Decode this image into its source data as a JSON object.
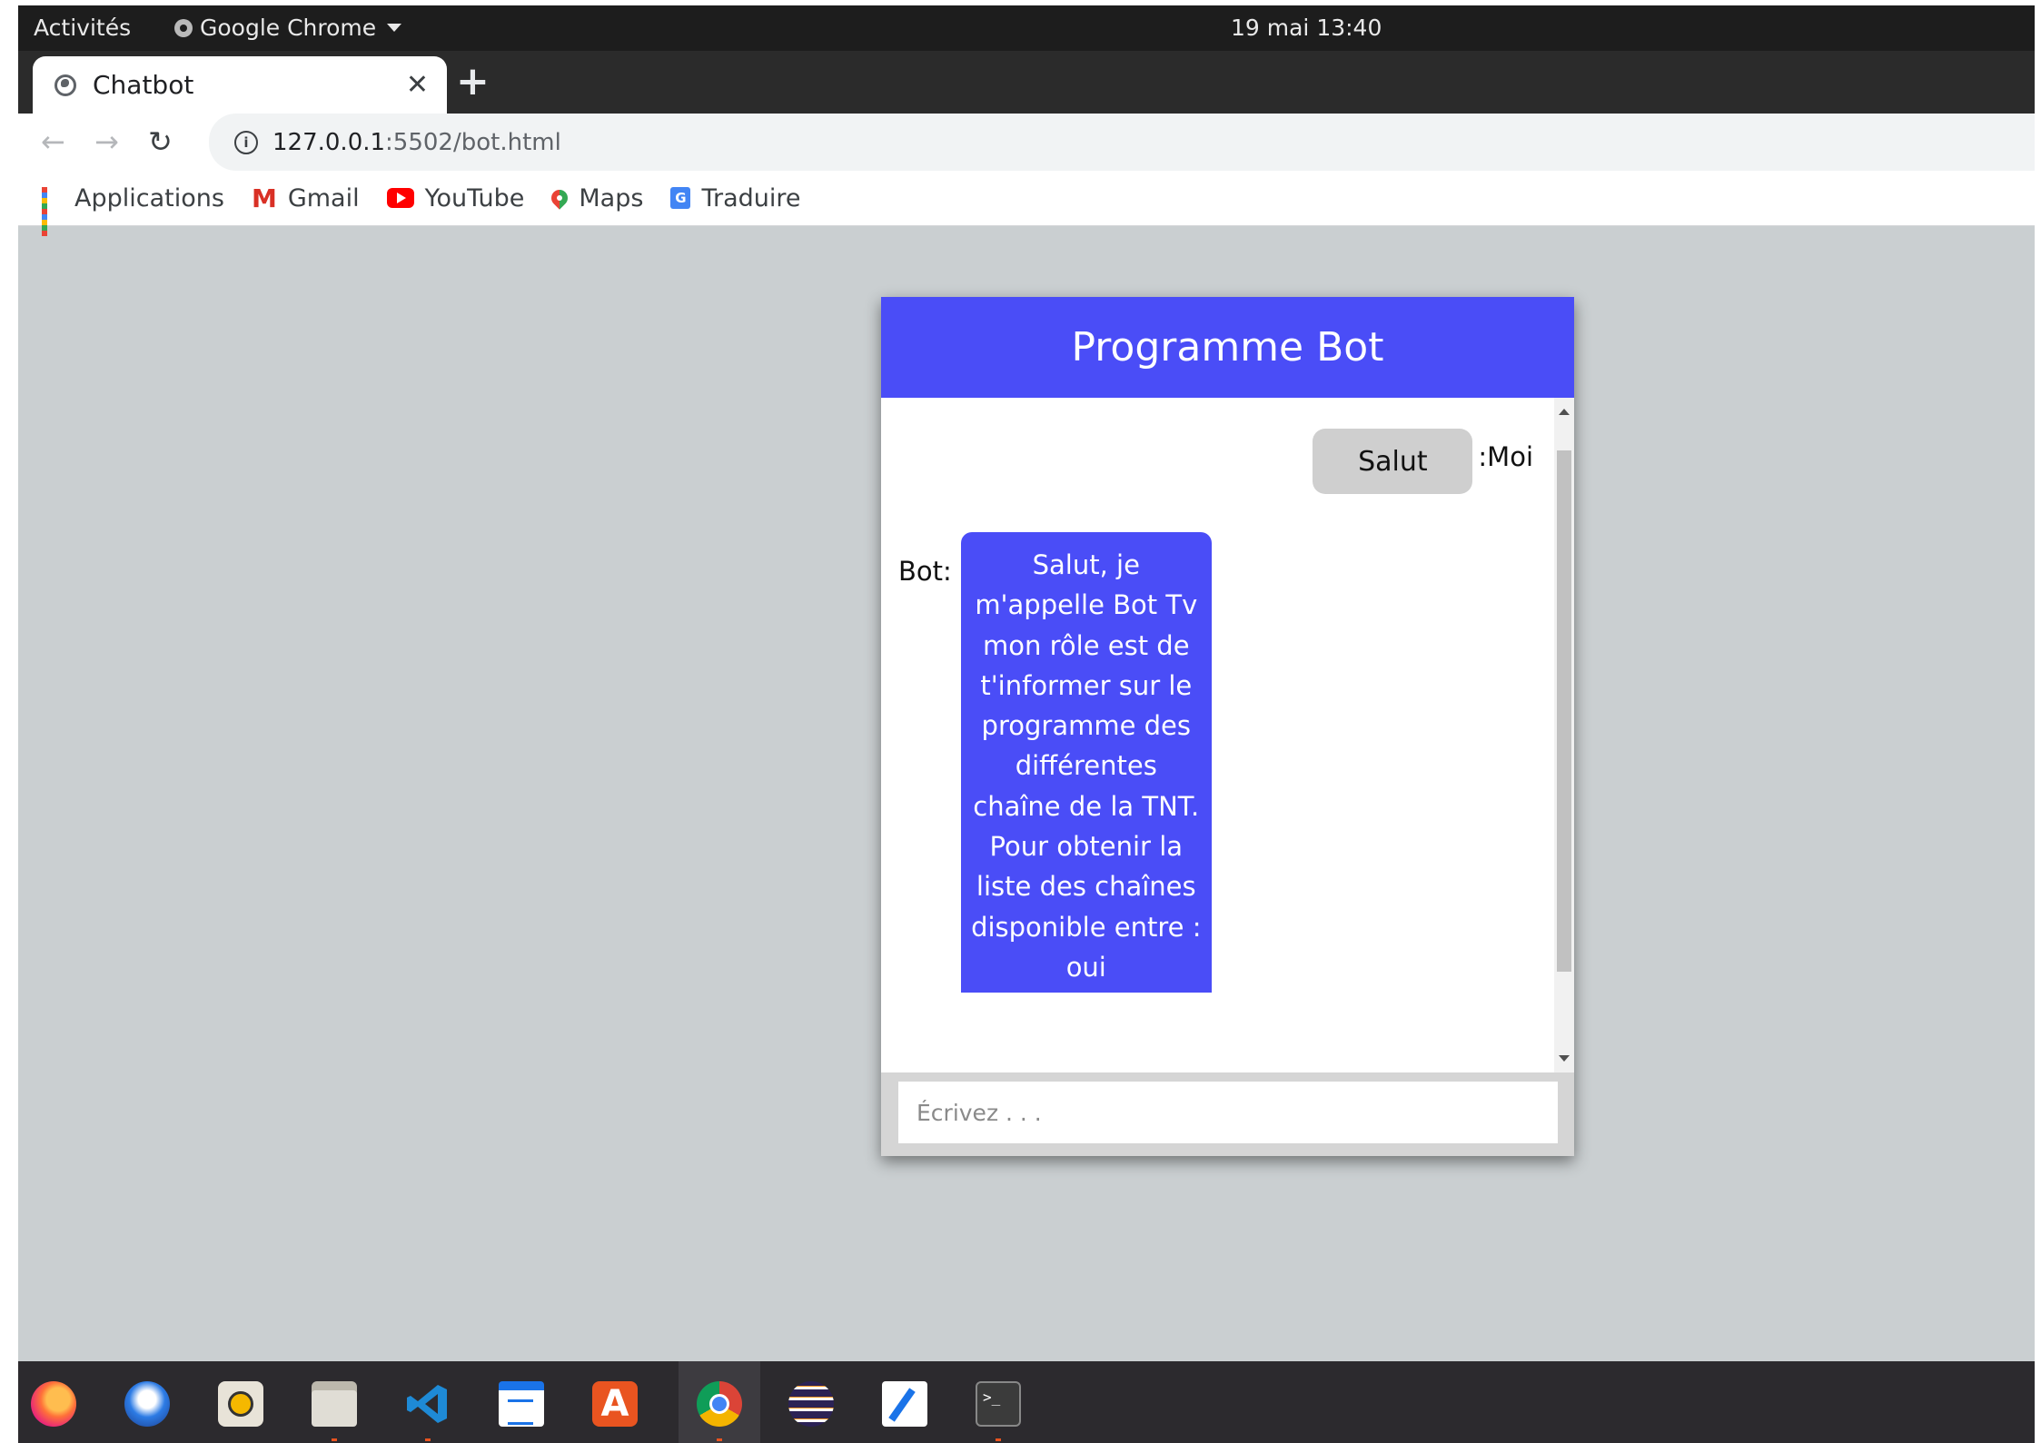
{
  "system_bar": {
    "activities": "Activités",
    "app_name": "Google Chrome",
    "clock": "19 mai  13:40"
  },
  "browser": {
    "tab_title": "Chatbot",
    "url_host": "127.0.0.1",
    "url_rest": ":5502/bot.html",
    "bookmarks": [
      "Applications",
      "Gmail",
      "YouTube",
      "Maps",
      "Traduire"
    ]
  },
  "chat": {
    "title": "Programme Bot",
    "user_message": "Salut",
    "user_label": ":Moi",
    "bot_label": "Bot:",
    "bot_message": "Salut, je m'appelle Bot Tv mon rôle est de t'informer sur le programme des différentes chaîne de la TNT. Pour obtenir la liste des chaînes disponible entre : oui",
    "input_placeholder": "Écrivez . . ."
  },
  "dock": {
    "apps": [
      "firefox-icon",
      "thunderbird-icon",
      "rhythmbox-icon",
      "files-icon",
      "vscode-icon",
      "libreoffice-writer-icon",
      "app-store-icon",
      "chrome-icon",
      "eclipse-icon",
      "text-editor-icon",
      "terminal-icon"
    ],
    "accent_color": "#e95420"
  },
  "colors": {
    "chat_accent": "#4a4df7",
    "page_background": "#cacfd1"
  }
}
